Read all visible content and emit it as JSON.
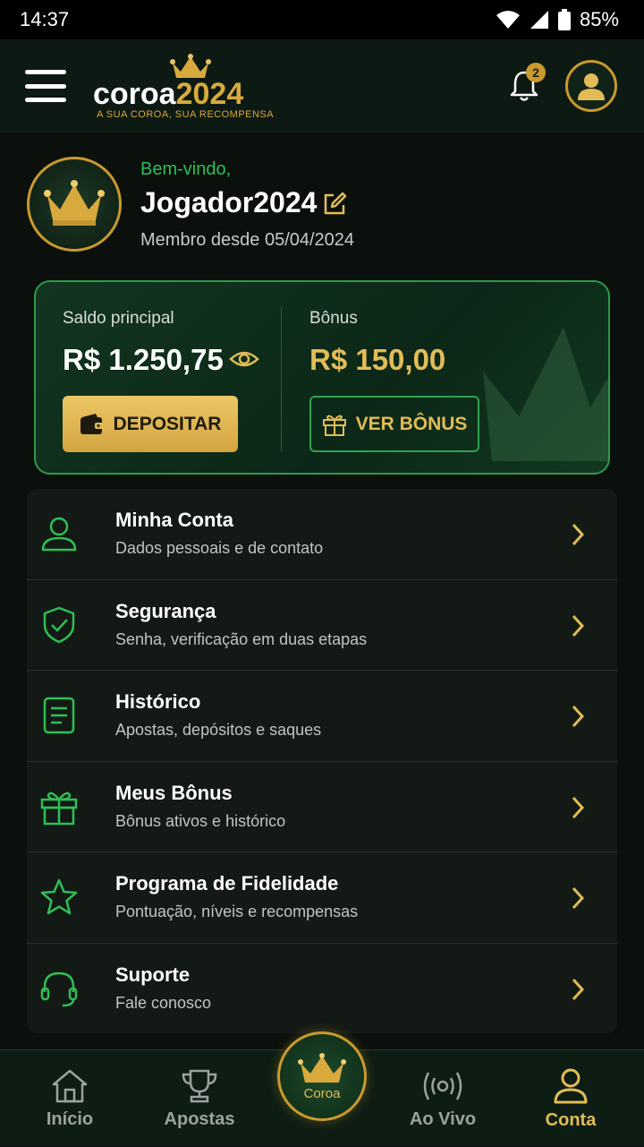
{
  "status_bar": {
    "time": "14:37",
    "battery": "85%"
  },
  "header": {
    "logo_word_white": "coroa",
    "logo_word_gold": "2024",
    "tagline": "A SUA COROA, SUA RECOMPENSA",
    "notifications_count": "2"
  },
  "profile": {
    "welcome": "Bem-vindo,",
    "username": "Jogador2024",
    "member_since": "Membro desde 05/04/2024"
  },
  "balance": {
    "main_label": "Saldo principal",
    "main_value": "R$ 1.250,75",
    "bonus_label": "Bônus",
    "bonus_value": "R$ 150,00",
    "deposit_label": "DEPOSITAR",
    "view_bonus_label": "VER BÔNUS"
  },
  "menu": [
    {
      "title": "Minha Conta",
      "subtitle": "Dados pessoais e de contato",
      "icon": "user-icon"
    },
    {
      "title": "Segurança",
      "subtitle": "Senha, verificação em duas etapas",
      "icon": "shield-check-icon"
    },
    {
      "title": "Histórico",
      "subtitle": "Apostas, depósitos e saques",
      "icon": "document-icon"
    },
    {
      "title": "Meus Bônus",
      "subtitle": "Bônus ativos e histórico",
      "icon": "gift-icon"
    },
    {
      "title": "Programa de Fidelidade",
      "subtitle": "Pontuação, níveis e recompensas",
      "icon": "star-icon"
    },
    {
      "title": "Suporte",
      "subtitle": "Fale conosco",
      "icon": "headset-icon"
    }
  ],
  "bottom_nav": {
    "home": "Início",
    "bets": "Apostas",
    "center": "Coroa",
    "live": "Ao Vivo",
    "account": "Conta"
  },
  "colors": {
    "accent_green": "#2fbf55",
    "gold": "#d8aa3e",
    "background": "#0b100d"
  }
}
